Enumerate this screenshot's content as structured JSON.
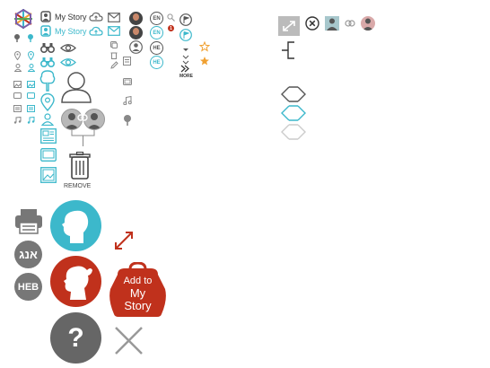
{
  "sprite": {
    "my_story_label_dark": "My Story",
    "my_story_label_teal": "My Story",
    "lang_en_dark": "EN",
    "lang_en_teal": "EN",
    "lang_he_dark": "HE",
    "lang_he_teal": "HE",
    "more_label": "MORE",
    "remove_label": "REMOVE",
    "big_lang_hebrew": "אנג",
    "big_lang_heb": "HEB",
    "add_to_my_story": [
      "Add to",
      "My",
      "Story"
    ],
    "help_symbol": "?",
    "notification_count": "1"
  },
  "colors": {
    "teal": "#3cb8cb",
    "dark_gray": "#555555",
    "mid_gray": "#888888",
    "light_gray": "#bbbbbb",
    "red": "#c0311c",
    "orange": "#f0a030",
    "white": "#ffffff"
  }
}
